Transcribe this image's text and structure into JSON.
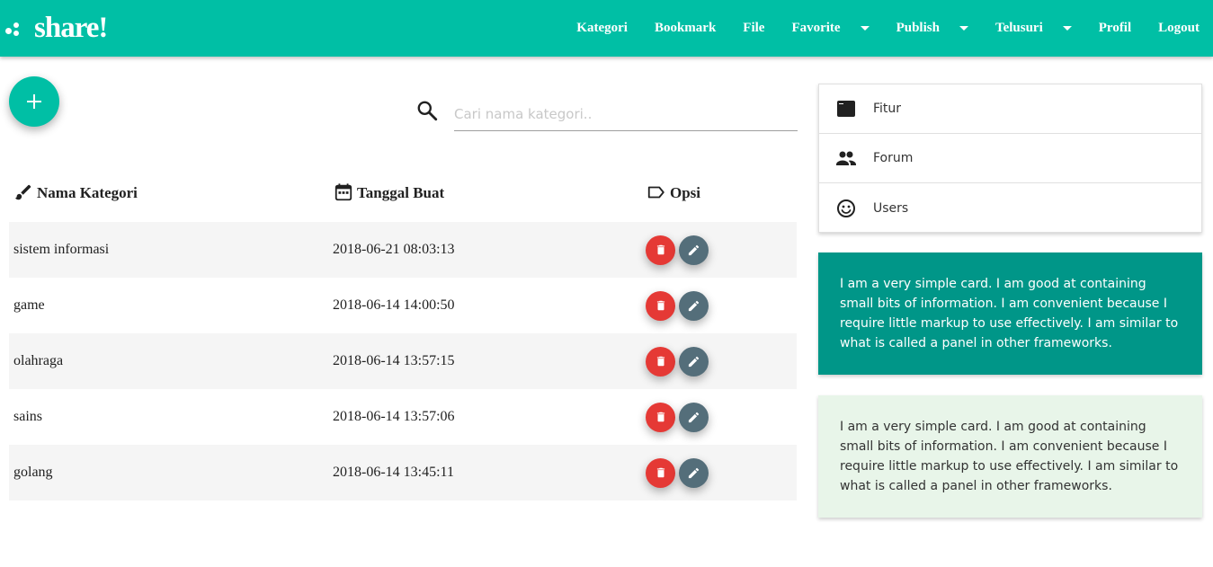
{
  "brand": {
    "name": "share!"
  },
  "nav": [
    {
      "label": "Kategori",
      "dropdown": false
    },
    {
      "label": "Bookmark",
      "dropdown": false
    },
    {
      "label": "File",
      "dropdown": false
    },
    {
      "label": "Favorite",
      "dropdown": true
    },
    {
      "label": "Publish",
      "dropdown": true
    },
    {
      "label": "Telusuri",
      "dropdown": true
    },
    {
      "label": "Profil",
      "dropdown": false
    },
    {
      "label": "Logout",
      "dropdown": false
    }
  ],
  "search": {
    "placeholder": "Cari nama kategori.."
  },
  "table": {
    "headers": {
      "name": "Nama Kategori",
      "date": "Tanggal Buat",
      "options": "Opsi"
    },
    "rows": [
      {
        "name": "sistem informasi",
        "date": "2018-06-21 08:03:13"
      },
      {
        "name": "game",
        "date": "2018-06-14 14:00:50"
      },
      {
        "name": "olahraga",
        "date": "2018-06-14 13:57:15"
      },
      {
        "name": "sains",
        "date": "2018-06-14 13:57:06"
      },
      {
        "name": "golang",
        "date": "2018-06-14 13:45:11"
      }
    ]
  },
  "side_menu": [
    {
      "label": "Fitur",
      "icon": "web-icon"
    },
    {
      "label": "Forum",
      "icon": "people-icon"
    },
    {
      "label": "Users",
      "icon": "smiley-icon"
    }
  ],
  "cards": [
    {
      "text": "I am a very simple card. I am good at containing small bits of information. I am convenient because I require little markup to use effectively. I am similar to what is called a panel in other frameworks.",
      "color": "#009688"
    },
    {
      "text": "I am a very simple card. I am good at containing small bits of information. I am convenient because I require little markup to use effectively. I am similar to what is called a panel in other frameworks.",
      "color": "#e8f5e9"
    }
  ],
  "colors": {
    "primary": "#00bfa5",
    "danger": "#e53935",
    "edit": "#546e7a"
  }
}
